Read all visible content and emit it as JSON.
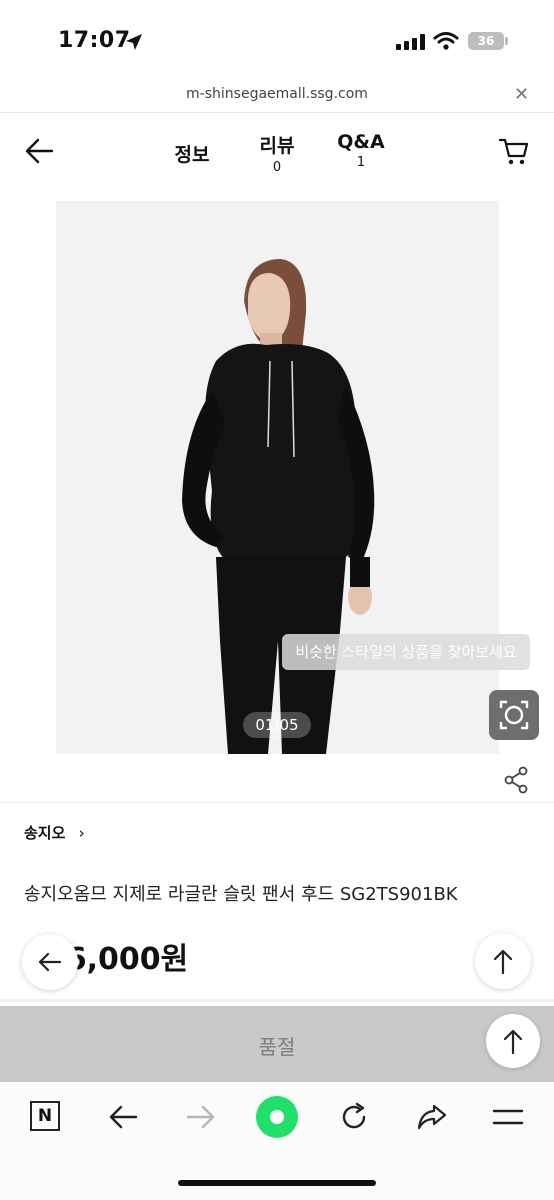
{
  "status_bar": {
    "time": "17:07",
    "battery": "36"
  },
  "browser": {
    "url": "m-shinsegaemall.ssg.com"
  },
  "header": {
    "tabs": [
      {
        "label": "정보",
        "count": ""
      },
      {
        "label": "리뷰",
        "count": "0"
      },
      {
        "label": "Q&A",
        "count": "1"
      }
    ]
  },
  "image": {
    "counter": "01/05",
    "tooltip": "비슷한 스타일의 상품을 찾아보세요"
  },
  "product": {
    "brand": "송지오",
    "name": "송지오옴므 지제로 라글란 슬릿 팬서 후드 SG2TS901BK",
    "price": "236,000원"
  },
  "cta": {
    "label": "품절"
  },
  "colors": {
    "soldout_bg": "#c9c9c9",
    "accent_green": "#1ee06a"
  },
  "icons": [
    "back-arrow-icon",
    "cart-icon",
    "lens-search-icon",
    "share-icon",
    "scroll-top-icon",
    "naver-n-icon",
    "browser-back-icon",
    "browser-forward-icon",
    "green-dot-icon",
    "refresh-icon",
    "share-arrow-icon",
    "menu-icon"
  ]
}
